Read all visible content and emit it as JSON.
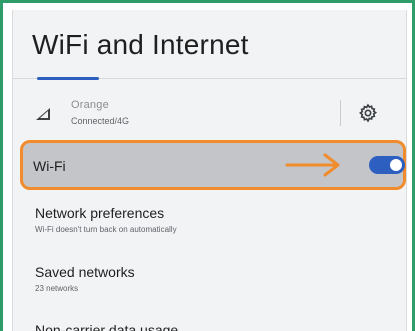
{
  "header": {
    "title": "WiFi and Internet"
  },
  "mobile_network": {
    "carrier": "Orange",
    "status": "Connected/4G",
    "signal_icon": "cell-signal-icon",
    "settings_icon": "gear-icon"
  },
  "wifi": {
    "label": "Wi-Fi",
    "enabled": true,
    "highlight_color": "#f08c2b",
    "arrow_icon": "arrow-right-icon"
  },
  "list": [
    {
      "title": "Network preferences",
      "subtitle": "Wi-Fi doesn't turn back on automatically"
    },
    {
      "title": "Saved networks",
      "subtitle": "23 networks"
    }
  ],
  "partial_item": {
    "title": "Non-carrier data usage"
  },
  "colors": {
    "accent": "#2d5fc0",
    "frame": "#2e9d6a",
    "highlight": "#f08c2b"
  }
}
